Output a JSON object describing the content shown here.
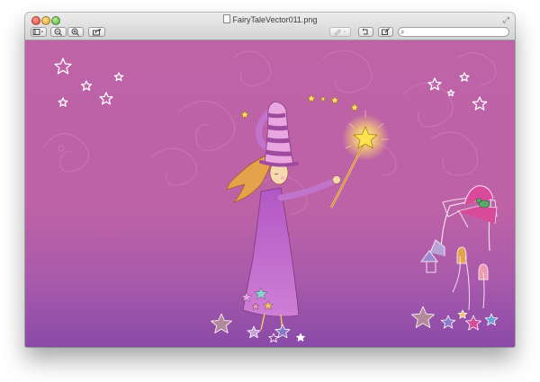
{
  "window": {
    "title": "FairyTaleVector011.png"
  },
  "toolbar": {
    "sidebar_toggle_icon": "sidebar-toggle-icon",
    "zoom_out_icon": "zoom-out-icon",
    "zoom_in_icon": "zoom-in-icon",
    "share_icon": "share-icon",
    "markup_icon": "pen-icon",
    "rotate_icon": "rotate-icon",
    "edit_icon": "edit-toolbox-icon",
    "search_icon": "magnifier-icon",
    "search_value": ""
  },
  "image": {
    "subject": "fairy-with-wand-illustration",
    "colors": {
      "background_top": "#bf63a7",
      "background_bottom": "#8a4aa8",
      "dress": "#a54cb8",
      "hat_stripe_light": "#e9a6e0",
      "hat_stripe_dark": "#9d4a9f",
      "hair": "#e6a24a",
      "star_glow": "#ffe26a",
      "house_roof": "#d94a9a"
    }
  }
}
